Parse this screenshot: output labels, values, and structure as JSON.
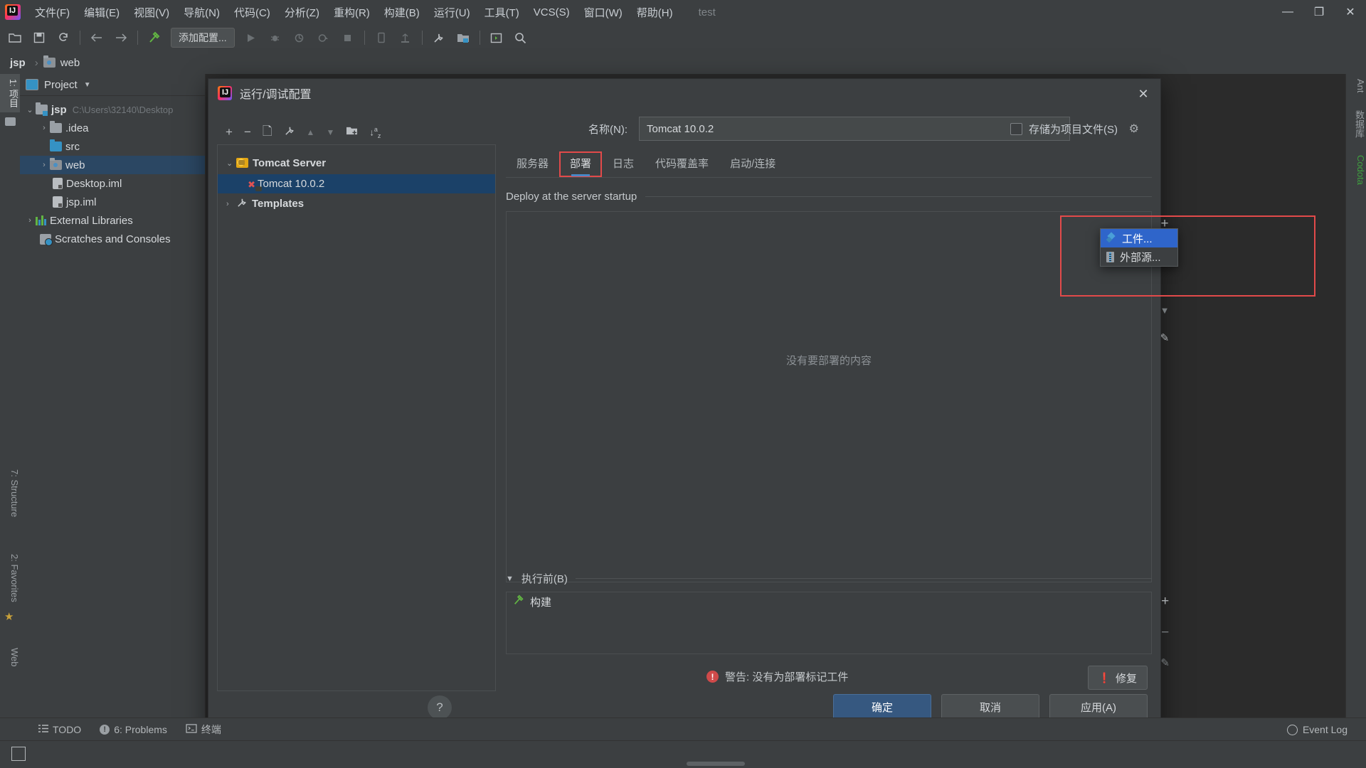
{
  "window": {
    "title": "test",
    "controls": {
      "minimize": "—",
      "maximize": "❐",
      "close": "✕"
    }
  },
  "menubar": [
    {
      "label": "文件(F)",
      "name": "menu-file"
    },
    {
      "label": "编辑(E)",
      "name": "menu-edit"
    },
    {
      "label": "视图(V)",
      "name": "menu-view"
    },
    {
      "label": "导航(N)",
      "name": "menu-navigate"
    },
    {
      "label": "代码(C)",
      "name": "menu-code"
    },
    {
      "label": "分析(Z)",
      "name": "menu-analyze"
    },
    {
      "label": "重构(R)",
      "name": "menu-refactor"
    },
    {
      "label": "构建(B)",
      "name": "menu-build"
    },
    {
      "label": "运行(U)",
      "name": "menu-run"
    },
    {
      "label": "工具(T)",
      "name": "menu-tools"
    },
    {
      "label": "VCS(S)",
      "name": "menu-vcs"
    },
    {
      "label": "窗口(W)",
      "name": "menu-window"
    },
    {
      "label": "帮助(H)",
      "name": "menu-help"
    }
  ],
  "toolbar": {
    "add_config_label": "添加配置...",
    "icons": [
      "open-folder-icon",
      "save-icon",
      "sync-icon",
      "back-arrow-icon",
      "forward-arrow-icon",
      "build-hammer-icon",
      "run-icon",
      "debug-icon",
      "run-with-coverage-icon",
      "profile-icon",
      "stop-icon",
      "device-icon",
      "upload-icon",
      "settings-wrench-icon",
      "project-structure-icon",
      "terminal-icon",
      "search-icon"
    ]
  },
  "breadcrumb": {
    "project": "jsp",
    "current": "web"
  },
  "left_stripe": {
    "project_tab": "1: 项目",
    "structure_tab": "7: Structure",
    "favorites_tab": "2: Favorites",
    "web_tab": "Web"
  },
  "right_stripe": {
    "ant_tab": "Ant",
    "maven_tab": "数据库",
    "codota_tab": "Codota"
  },
  "project_panel": {
    "title": "Project",
    "tree": [
      {
        "label": "jsp",
        "path": "C:\\Users\\32140\\Desktop",
        "icon": "module-folder-icon",
        "arrow": "⌄",
        "indent": 0,
        "bold": true,
        "selected": false
      },
      {
        "label": ".idea",
        "path": "",
        "icon": "folder-icon",
        "arrow": "›",
        "indent": 1,
        "bold": false,
        "selected": false
      },
      {
        "label": "src",
        "path": "",
        "icon": "source-folder-icon",
        "arrow": "",
        "indent": 1,
        "bold": false,
        "selected": false
      },
      {
        "label": "web",
        "path": "",
        "icon": "web-folder-icon",
        "arrow": "›",
        "indent": 1,
        "bold": false,
        "selected": true
      },
      {
        "label": "Desktop.iml",
        "path": "",
        "icon": "iml-file-icon",
        "arrow": "",
        "indent": 1,
        "bold": false,
        "selected": false
      },
      {
        "label": "jsp.iml",
        "path": "",
        "icon": "iml-file-icon",
        "arrow": "",
        "indent": 1,
        "bold": false,
        "selected": false
      },
      {
        "label": "External Libraries",
        "path": "",
        "icon": "libraries-icon",
        "arrow": "›",
        "indent": 0,
        "bold": false,
        "selected": false
      },
      {
        "label": "Scratches and Consoles",
        "path": "",
        "icon": "scratches-icon",
        "arrow": "",
        "indent": 0,
        "bold": false,
        "selected": false
      }
    ]
  },
  "dialog": {
    "title": "运行/调试配置",
    "close_icon": "✕",
    "config_tree": [
      {
        "label": "Tomcat Server",
        "icon": "tomcat-icon",
        "arrow": "⌄",
        "indent": 0,
        "bold": true,
        "selected": false
      },
      {
        "label": "Tomcat 10.0.2",
        "icon": "tomcat-error-icon",
        "arrow": "",
        "indent": 1,
        "bold": false,
        "selected": true
      },
      {
        "label": "Templates",
        "icon": "wrench-icon",
        "arrow": "›",
        "indent": 0,
        "bold": true,
        "selected": false
      }
    ],
    "tree_toolbar": [
      "add-icon",
      "remove-icon",
      "copy-icon",
      "edit-wrench-icon",
      "move-up-icon",
      "move-down-icon",
      "new-folder-icon",
      "sort-alpha-icon"
    ],
    "name_label": "名称(N):",
    "name_value": "Tomcat 10.0.2",
    "store_as_project_file": "存储为项目文件(S)",
    "store_checked": false,
    "gear_icon": "gear-icon",
    "tabs": [
      {
        "label": "服务器",
        "name": "tab-server",
        "active": false,
        "outlined": false
      },
      {
        "label": "部署",
        "name": "tab-deployment",
        "active": true,
        "outlined": true
      },
      {
        "label": "日志",
        "name": "tab-logs",
        "active": false,
        "outlined": false
      },
      {
        "label": "代码覆盖率",
        "name": "tab-code-coverage",
        "active": false,
        "outlined": false
      },
      {
        "label": "启动/连接",
        "name": "tab-startup-connection",
        "active": false,
        "outlined": false
      }
    ],
    "deploy_section_title": "Deploy at the server startup",
    "deploy_empty_text": "没有要部署的内容",
    "deploy_side_icons": [
      "add-icon",
      "remove-icon",
      "move-up-icon",
      "move-down-icon",
      "edit-pencil-icon"
    ],
    "before_launch": {
      "title": "执行前(B)",
      "rows": [
        {
          "label": "构建",
          "icon": "build-hammer-icon"
        }
      ],
      "side_icons": [
        "add-icon",
        "remove-icon",
        "edit-pencil-icon"
      ]
    },
    "warning": {
      "icon": "warning-icon",
      "text": "警告: 没有为部署标记工件"
    },
    "fix_button": {
      "label": "修复",
      "icon": "warning-icon"
    },
    "help_button": "?",
    "buttons": [
      {
        "label": "确定",
        "name": "ok-button",
        "primary": true
      },
      {
        "label": "取消",
        "name": "cancel-button",
        "primary": false
      },
      {
        "label": "应用(A)",
        "name": "apply-button",
        "primary": false
      }
    ]
  },
  "popup_menu": {
    "items": [
      {
        "label": "工件...",
        "icon": "artifact-icon",
        "selected": true,
        "name": "popup-item-artifact"
      },
      {
        "label": "外部源...",
        "icon": "external-source-icon",
        "selected": false,
        "name": "popup-item-external-source"
      }
    ]
  },
  "status_bar": {
    "items": [
      {
        "label": "TODO",
        "icon": "todo-icon",
        "name": "status-todo"
      },
      {
        "label": "6: Problems",
        "icon": "problems-icon",
        "name": "status-problems"
      },
      {
        "label": "终端",
        "icon": "terminal-icon",
        "name": "status-terminal"
      }
    ],
    "event_log": "Event Log"
  },
  "colors": {
    "accent_blue": "#2f65ca",
    "selection_blue": "#1b4168",
    "primary_button": "#365880",
    "warn_red": "#cf4a4a",
    "outline_red": "#e24a4a",
    "panel_bg": "#3c3f41",
    "editor_bg": "#2b2b2b"
  }
}
